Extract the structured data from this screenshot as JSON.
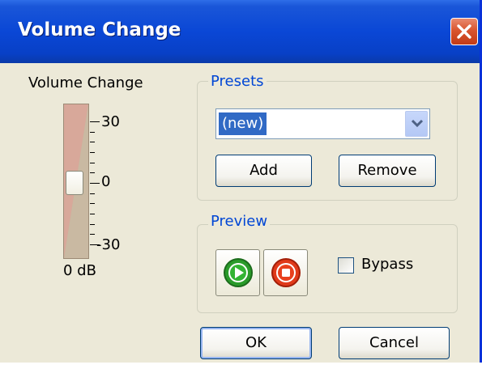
{
  "window": {
    "title": "Volume Change",
    "close_icon": "close-x-icon",
    "accent": "#0a47d6"
  },
  "volume": {
    "label": "Volume Change",
    "max_label": "30",
    "mid_label": "0",
    "min_label": "-30",
    "value_readout": "0 dB",
    "level_db": 0
  },
  "presets": {
    "caption": "Presets",
    "selected": "(new)",
    "add_label": "Add",
    "remove_label": "Remove"
  },
  "preview": {
    "caption": "Preview",
    "play_icon": "play-icon",
    "stop_icon": "stop-icon",
    "bypass_label": "Bypass",
    "bypass_checked": false
  },
  "footer": {
    "ok_label": "OK",
    "cancel_label": "Cancel"
  }
}
